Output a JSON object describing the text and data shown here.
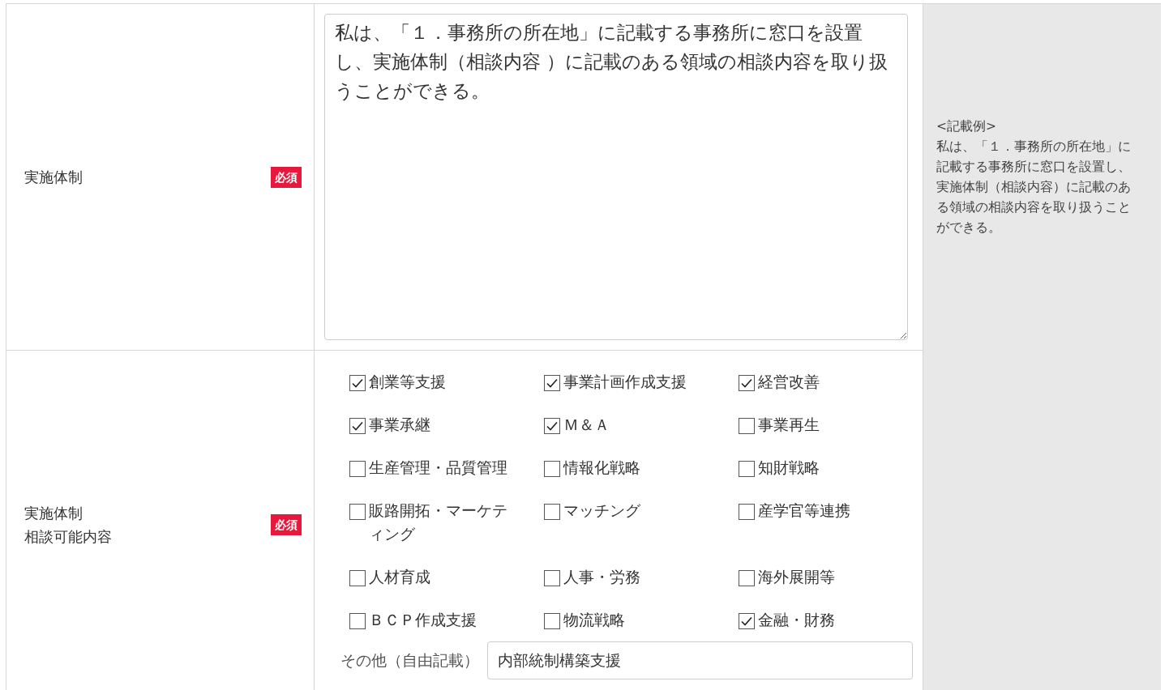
{
  "rows": [
    {
      "kind": "textarea",
      "label": [
        "実施体制"
      ],
      "required_badge": "必須",
      "value": "私は、「１．事務所の所在地」に記載する事務所に窓口を設置し、実施体制（相談内容 ）に記載のある領域の相談内容を取り扱うことができる。",
      "example": "<記載例>\n私は、「１．事務所の所在地」に記載する事務所に窓口を設置し、実施体制（相談内容）に記載のある領域の相談内容を取り扱うことができる。"
    },
    {
      "kind": "checkboxes",
      "label": [
        "実施体制",
        "相談可能内容"
      ],
      "required_badge": "必須",
      "options": [
        {
          "label": "創業等支援",
          "checked": true
        },
        {
          "label": "事業計画作成支援",
          "checked": true
        },
        {
          "label": "経営改善",
          "checked": true
        },
        {
          "label": "事業承継",
          "checked": true
        },
        {
          "label": "Ｍ＆Ａ",
          "checked": true
        },
        {
          "label": "事業再生",
          "checked": false
        },
        {
          "label": "生産管理・品質管理",
          "checked": false
        },
        {
          "label": "情報化戦略",
          "checked": false
        },
        {
          "label": "知財戦略",
          "checked": false
        },
        {
          "label": "販路開拓・マーケティング",
          "checked": false
        },
        {
          "label": "マッチング",
          "checked": false
        },
        {
          "label": "産学官等連携",
          "checked": false
        },
        {
          "label": "人材育成",
          "checked": false
        },
        {
          "label": "人事・労務",
          "checked": false
        },
        {
          "label": "海外展開等",
          "checked": false
        },
        {
          "label": "ＢＣＰ作成支援",
          "checked": false
        },
        {
          "label": "物流戦略",
          "checked": false
        },
        {
          "label": "金融・財務",
          "checked": true
        }
      ],
      "other_label": "その他（自由記載）",
      "other_value": "内部統制構築支援"
    }
  ]
}
